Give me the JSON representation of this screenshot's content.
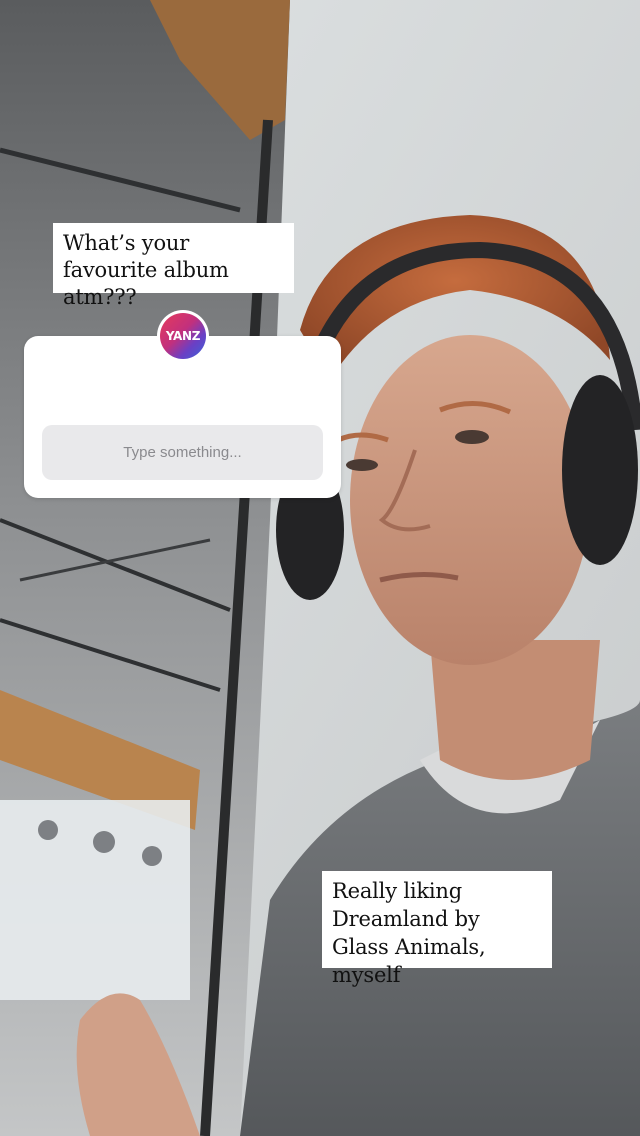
{
  "story": {
    "question_caption": "What’s your favourite album atm???",
    "question_sticker": {
      "avatar_text": "YANZ",
      "answer_placeholder": "Type something..."
    },
    "reply_caption": "Really liking Dreamland by Glass Animals, myself"
  },
  "colors": {
    "sticker_background": "#ffffff",
    "answer_field_background": "#e9e9eb",
    "placeholder_text": "#8a8a8e",
    "avatar_gradient_start": "#e63b5a",
    "avatar_gradient_end": "#3a63d8"
  },
  "icons": [
    "avatar-icon"
  ]
}
